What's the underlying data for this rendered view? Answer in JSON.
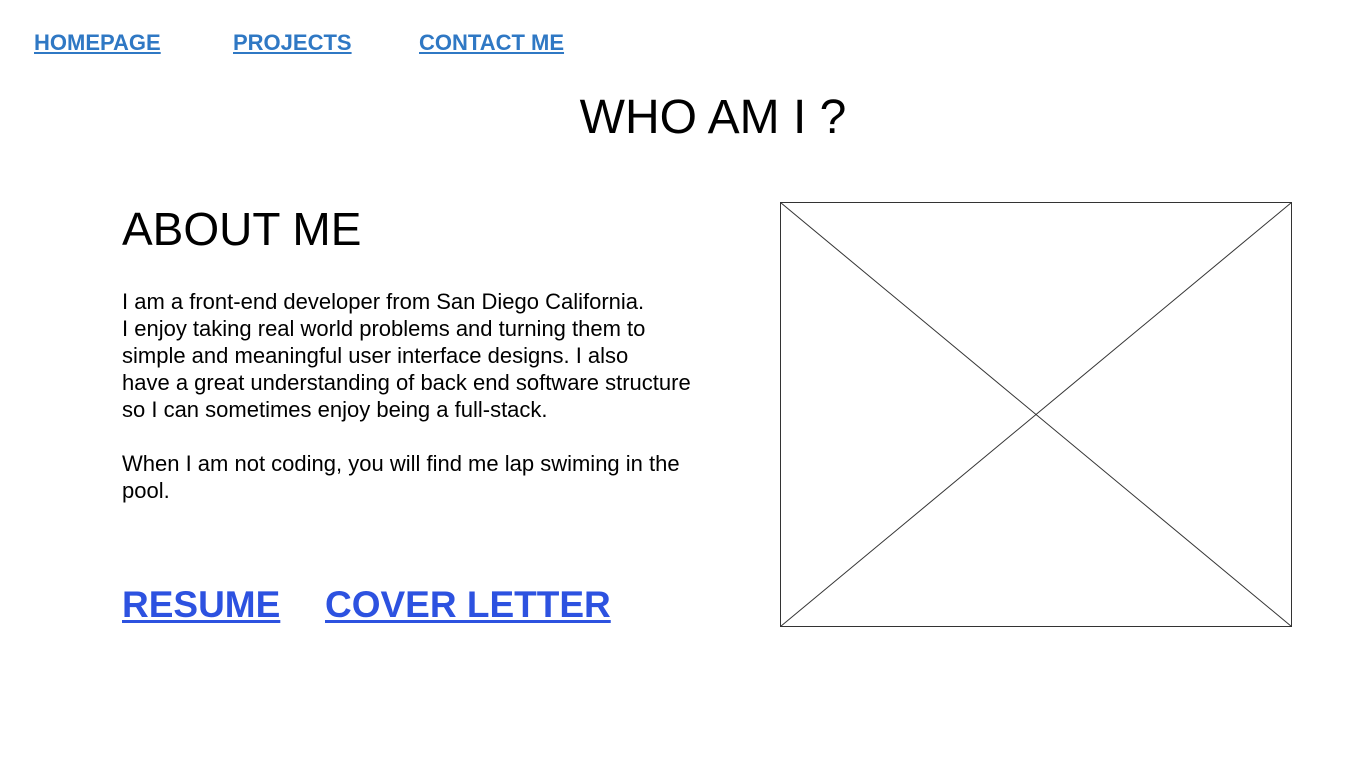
{
  "nav": {
    "items": [
      {
        "label": "HOMEPAGE"
      },
      {
        "label": "PROJECTS"
      },
      {
        "label": "CONTACT ME"
      }
    ]
  },
  "header": {
    "title": "WHO AM I ?"
  },
  "about": {
    "heading": "ABOUT ME",
    "paragraph1_lines": [
      "I am a front-end developer from San Diego California.",
      "I enjoy taking real world problems and turning them to",
      "simple and meaningful user interface designs. I also",
      "have a great understanding of back end software structure",
      "so I can sometimes enjoy being a full-stack."
    ],
    "paragraph2_lines": [
      "When I am not coding, you will find me lap swiming in the",
      "pool."
    ],
    "links": {
      "resume": "RESUME",
      "cover_letter": "COVER LETTER"
    }
  },
  "colors": {
    "nav_link": "#2f78c4",
    "doc_link": "#2d52e0",
    "text": "#000000",
    "placeholder_stroke": "#333333"
  },
  "icons": {
    "photo_placeholder": "image-placeholder-icon"
  }
}
